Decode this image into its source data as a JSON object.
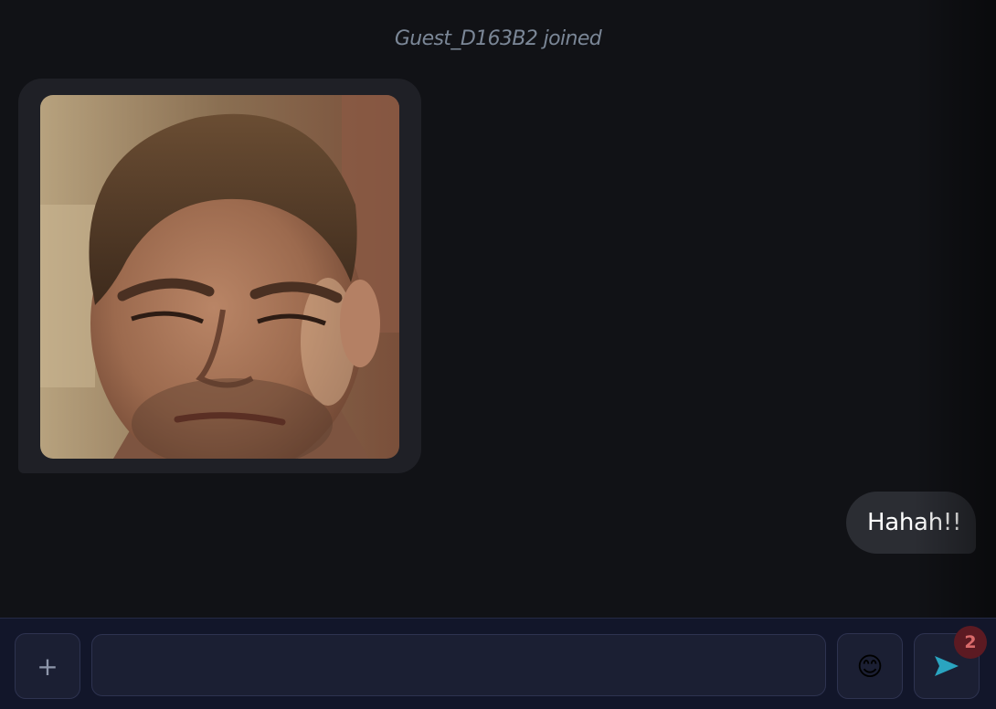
{
  "chat": {
    "system_message": "Guest_D163B2 joined",
    "messages": [
      {
        "type": "image",
        "side": "left",
        "content": "photo of a man's face"
      },
      {
        "type": "text",
        "side": "right",
        "text": "Hahah!!"
      }
    ]
  },
  "composer": {
    "attach_label": "+",
    "input_value": "",
    "input_placeholder": "",
    "emoji_label": "😊",
    "send_icon": "send-arrow-icon",
    "unread_badge": "2"
  },
  "colors": {
    "background": "#111216",
    "bubble_other": "#1f2026",
    "bubble_self": "#2b2d33",
    "composer_bg": "#12162a",
    "send_accent": "#2aa4c0",
    "badge_bg": "#5c1a22"
  }
}
